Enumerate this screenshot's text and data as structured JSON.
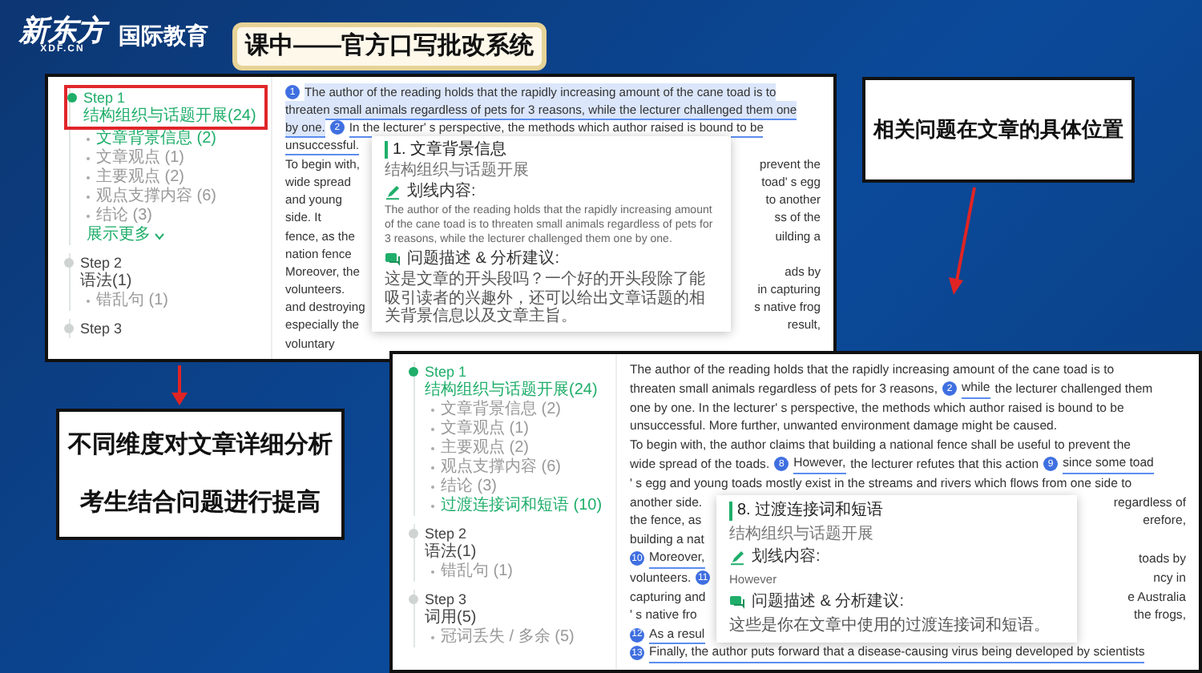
{
  "logo": {
    "brand": "新东方",
    "domain": "XDF.CN",
    "division": "国际教育"
  },
  "title_banner": "课中——官方口写批改系统",
  "screenshots": [
    {
      "sidebar": {
        "steps": [
          {
            "label": "Step 1",
            "category": "结构组织与话题开展(24)",
            "selected": true,
            "outlined": true,
            "items": [
              {
                "label": "文章背景信息 (2)",
                "selected": true
              },
              {
                "label": "文章观点 (1)",
                "selected": false
              },
              {
                "label": "主要观点 (2)",
                "selected": false
              },
              {
                "label": "观点支撑内容 (6)",
                "selected": false
              },
              {
                "label": "结论 (3)",
                "selected": false
              }
            ],
            "more": "展示更多"
          },
          {
            "label": "Step 2",
            "category": "语法(1)",
            "selected": false,
            "items": [
              {
                "label": "错乱句 (1)",
                "selected": false
              }
            ]
          },
          {
            "label": "Step 3",
            "selected": false
          }
        ]
      },
      "passage": [
        {
          "segments": [
            {
              "marker": "1",
              "kind": "highlight",
              "text": "The author of the reading holds that the rapidly increasing amount of the cane toad is to"
            }
          ]
        },
        {
          "segments": [
            {
              "kind": "highlight",
              "text": "threaten small animals regardless of pets for 3 reasons, while the lecturer challenged them one"
            }
          ]
        },
        {
          "segments": [
            {
              "kind": "highlight",
              "text": "by one."
            },
            {
              "marker": "2",
              "kind": "underline",
              "text": "In the lecturer' s perspective, the methods which author raised is bound to be"
            }
          ]
        },
        {
          "segments": [
            {
              "kind": "underline",
              "text": "unsuccessful."
            }
          ]
        },
        {
          "segments": [
            {
              "kind": "plain",
              "text": "To begin with,"
            }
          ],
          "right": "prevent the"
        },
        {
          "segments": [
            {
              "kind": "plain",
              "text": "wide spread"
            }
          ],
          "right": "toad' s egg"
        },
        {
          "segments": [
            {
              "kind": "plain",
              "text": "and young"
            }
          ],
          "right": "to another"
        },
        {
          "segments": [
            {
              "kind": "plain",
              "text": "side. It"
            }
          ],
          "right": "ss of the"
        },
        {
          "segments": [
            {
              "kind": "plain",
              "text": "fence, as the"
            }
          ],
          "right": "uilding a"
        },
        {
          "segments": [
            {
              "kind": "plain",
              "text": "nation fence"
            }
          ]
        },
        {
          "segments": [
            {
              "kind": "plain",
              "text": "Moreover, the"
            }
          ],
          "right": "ads by"
        },
        {
          "segments": [
            {
              "kind": "plain",
              "text": "volunteers."
            }
          ],
          "right": "in capturing"
        },
        {
          "segments": [
            {
              "kind": "plain",
              "text": "and destroying"
            }
          ],
          "right": "s native frog"
        },
        {
          "segments": [
            {
              "kind": "plain",
              "text": "especially the"
            }
          ],
          "right": "result,"
        },
        {
          "segments": [
            {
              "kind": "plain",
              "text": "voluntary"
            }
          ]
        }
      ],
      "popover": {
        "title": "1. 文章背景信息",
        "category": "结构组织与话题开展",
        "quote_label": "划线内容:",
        "quote": "The author of the reading holds that the rapidly increasing amount of the cane toad is to threaten small animals regardless of pets for 3 reasons, while the lecturer challenged them one by one.",
        "advice_label": "问题描述 & 分析建议:",
        "advice": "这是文章的开头段吗？一个好的开头段除了能吸引读者的兴趣外，还可以给出文章话题的相关背景信息以及文章主旨。"
      }
    },
    {
      "sidebar": {
        "steps": [
          {
            "label": "Step 1",
            "category": "结构组织与话题开展(24)",
            "selected": true,
            "items": [
              {
                "label": "文章背景信息 (2)",
                "selected": false
              },
              {
                "label": "文章观点 (1)",
                "selected": false
              },
              {
                "label": "主要观点 (2)",
                "selected": false
              },
              {
                "label": "观点支撑内容 (6)",
                "selected": false
              },
              {
                "label": "结论 (3)",
                "selected": false
              },
              {
                "label": "过渡连接词和短语 (10)",
                "selected": true
              }
            ]
          },
          {
            "label": "Step 2",
            "category": "语法(1)",
            "selected": false,
            "items": [
              {
                "label": "错乱句 (1)",
                "selected": false
              }
            ]
          },
          {
            "label": "Step 3",
            "category": "词用(5)",
            "selected": false,
            "items": [
              {
                "label": "冠词丢失 / 多余 (5)",
                "selected": false
              }
            ]
          }
        ]
      },
      "passage": [
        {
          "segments": [
            {
              "kind": "plain",
              "text": "The author of the reading holds that the rapidly increasing amount of the cane toad is to"
            }
          ]
        },
        {
          "segments": [
            {
              "kind": "plain",
              "text": "threaten small animals regardless of pets for 3 reasons,"
            },
            {
              "marker": "2",
              "kind": "underline",
              "text": "while"
            },
            {
              "kind": "plain",
              "text": "the lecturer challenged them"
            }
          ]
        },
        {
          "segments": [
            {
              "kind": "plain",
              "text": "one by one. In the lecturer' s perspective, the methods which author raised is bound to be"
            }
          ]
        },
        {
          "segments": [
            {
              "kind": "plain",
              "text": "unsuccessful. More further, unwanted environment damage might be caused."
            }
          ]
        },
        {
          "segments": [
            {
              "kind": "plain",
              "text": "To begin with, the author claims that building a national fence shall be useful to prevent the"
            }
          ]
        },
        {
          "segments": [
            {
              "kind": "plain",
              "text": "wide spread of the toads."
            },
            {
              "marker": "8",
              "kind": "underline",
              "text": "However,"
            },
            {
              "kind": "plain",
              "text": "the lecturer refutes that this action"
            },
            {
              "marker": "9",
              "kind": "underline",
              "text": "since some toad"
            }
          ]
        },
        {
          "segments": [
            {
              "kind": "plain",
              "text": "' s egg and young toads mostly exist in the streams and rivers which flows from one side to"
            }
          ]
        },
        {
          "segments": [
            {
              "kind": "plain",
              "text": "another side."
            }
          ],
          "right": "regardless of"
        },
        {
          "segments": [
            {
              "kind": "plain",
              "text": "the fence, as"
            }
          ],
          "right": "erefore,"
        },
        {
          "segments": [
            {
              "kind": "plain",
              "text": "building a nat"
            }
          ]
        },
        {
          "segments": [
            {
              "marker": "10",
              "kind": "underline",
              "text": "Moreover,"
            }
          ],
          "right": "toads by"
        },
        {
          "segments": [
            {
              "kind": "plain",
              "text": "volunteers."
            },
            {
              "marker": "11"
            }
          ],
          "right": "ncy in"
        },
        {
          "segments": [
            {
              "kind": "plain",
              "text": "capturing and"
            }
          ],
          "right": "e Australia"
        },
        {
          "segments": [
            {
              "kind": "plain",
              "text": "' s native fro"
            }
          ],
          "right": "the frogs,"
        },
        {
          "segments": [
            {
              "marker": "12",
              "kind": "underline",
              "text": "As a resul"
            }
          ]
        },
        {
          "segments": [
            {
              "marker": "13",
              "kind": "underline",
              "text": "Finally, the author puts forward that a disease-causing virus being developed by scientists"
            }
          ]
        }
      ],
      "popover": {
        "title": "8. 过渡连接词和短语",
        "category": "结构组织与话题开展",
        "quote_label": "划线内容:",
        "quote": "However",
        "advice_label": "问题描述 & 分析建议:",
        "advice": "这些是你在文章中使用的过渡连接词和短语。"
      }
    }
  ],
  "callouts": [
    {
      "lines": [
        "不同维度对文章详细分析",
        "考生结合问题进行提高"
      ]
    },
    {
      "lines": [
        "相关问题在文章的具体位置"
      ]
    }
  ]
}
